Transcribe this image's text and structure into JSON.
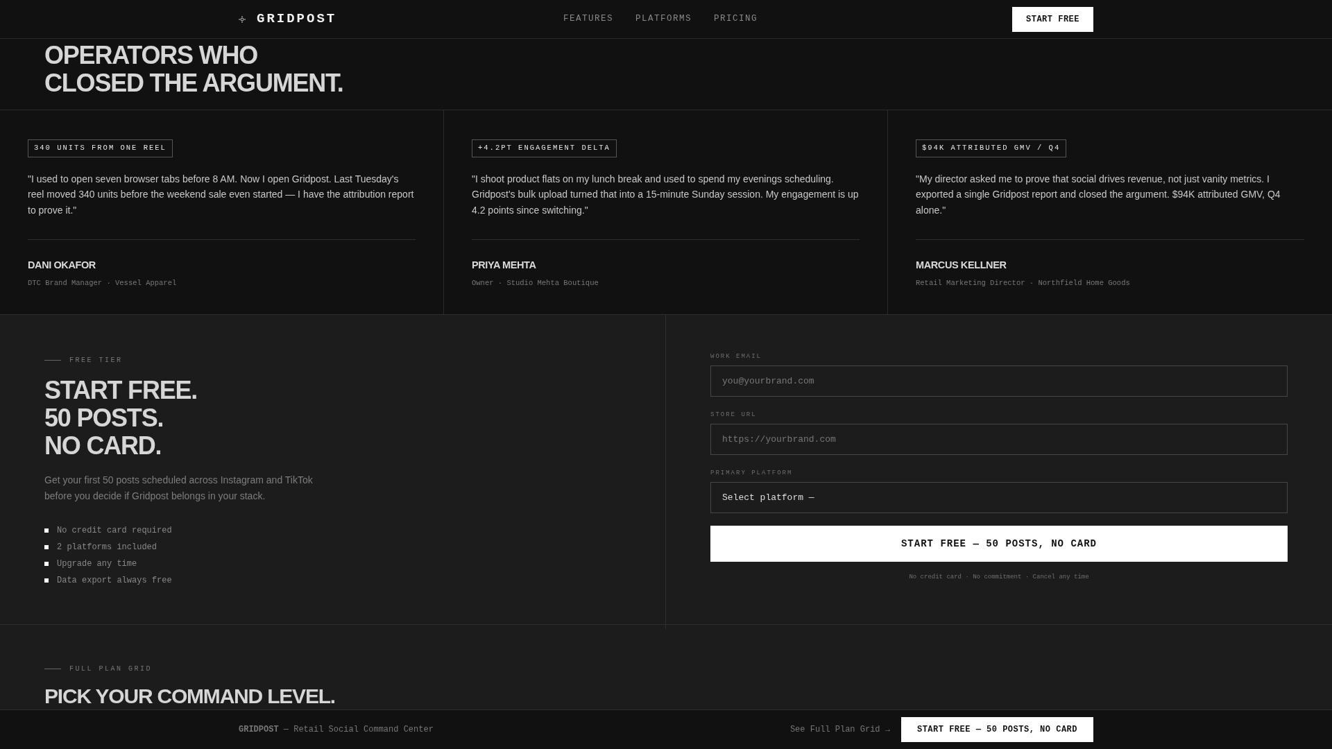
{
  "nav": {
    "brand": "GRIDPOST",
    "links": [
      "FEATURES",
      "PLATFORMS",
      "PRICING"
    ],
    "cta": "START FREE"
  },
  "hero": {
    "heading_lines": [
      "OPERATORS WHO",
      "CLOSED THE ARGUMENT."
    ]
  },
  "testimonials": [
    {
      "tag": "340 UNITS FROM ONE REEL",
      "quote": "\"I used to open seven browser tabs before 8 AM. Now I open Gridpost. Last Tuesday's reel moved 340 units before the weekend sale even started — I have the attribution report to prove it.\"",
      "name": "DANI OKAFOR",
      "role": "DTC Brand Manager · Vessel Apparel"
    },
    {
      "tag": "+4.2PT ENGAGEMENT DELTA",
      "quote": "\"I shoot product flats on my lunch break and used to spend my evenings scheduling. Gridpost's bulk upload turned that into a 15-minute Sunday session. My engagement is up 4.2 points since switching.\"",
      "name": "PRIYA MEHTA",
      "role": "Owner · Studio Mehta Boutique"
    },
    {
      "tag": "$94K ATTRIBUTED GMV / Q4",
      "quote": "\"My director asked me to prove that social drives revenue, not just vanity metrics. I exported a single Gridpost report and closed the argument. $94K attributed GMV, Q4 alone.\"",
      "name": "MARCUS KELLNER",
      "role": "Retail Marketing Director · Northfield Home Goods"
    }
  ],
  "free_tier": {
    "eyebrow": "FREE TIER",
    "heading_lines": [
      "START FREE.",
      "50 POSTS.",
      "NO CARD."
    ],
    "description": "Get your first 50 posts scheduled across Instagram and TikTok before you decide if Gridpost belongs in your stack.",
    "features": [
      "No credit card required",
      "2 platforms included",
      "Upgrade any time",
      "Data export always free"
    ]
  },
  "signup_form": {
    "fields": [
      {
        "kind": "input",
        "label": "WORK EMAIL",
        "placeholder": "you@yourbrand.com"
      },
      {
        "kind": "input",
        "label": "STORE URL",
        "placeholder": "https://yourbrand.com"
      },
      {
        "kind": "select",
        "label": "PRIMARY PLATFORM",
        "value": "Select platform —"
      }
    ],
    "submit": "START FREE — 50 POSTS, NO CARD",
    "note": "No credit card · No commitment · Cancel any time"
  },
  "plans": {
    "eyebrow": "FULL PLAN GRID",
    "heading": "PICK YOUR COMMAND LEVEL."
  },
  "footer": {
    "brand_line": "**GRIDPOST** — Retail Social Command Center",
    "link": "See Full Plan Grid →",
    "cta": "START FREE — 50 POSTS, NO CARD"
  }
}
